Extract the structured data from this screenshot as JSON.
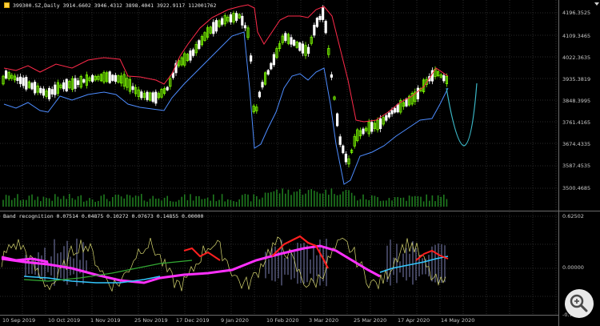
{
  "header": {
    "symbol_line": "399300.SZ,Daily  3914.6602 3946.4312 3898.4041 3922.9117  112001762"
  },
  "indicator": {
    "label_line": "Band recognition 0.07514 0.04875 0.10272 0.07673 0.14855 0.00000"
  },
  "price_scale": {
    "main": [
      "4196.3525",
      "4109.3465",
      "4022.3635",
      "3935.3819",
      "3848.3995",
      "3761.4165",
      "3674.4335",
      "3587.4535",
      "3500.4685"
    ],
    "sub": [
      "0.62502",
      "0.00000",
      "-0.74"
    ]
  },
  "time_scale": [
    "10 Sep 2019",
    "10 Oct 2019",
    "1 Nov 2019",
    "25 Nov 2019",
    "17 Dec 2019",
    "9 Jan 2020",
    "10 Feb 2020",
    "3 Mar 2020",
    "25 Mar 2020",
    "17 Apr 2020",
    "14 May 2020"
  ],
  "colors": {
    "background": "#000000",
    "grid": "#2a2a2a",
    "candle_up": "#7cfc00",
    "candle_down": "#ffffff",
    "band_upper": "#ff2a4a",
    "band_lower": "#4d8cff",
    "forecast": "#3bb8c8",
    "volume": "#1f7a1f",
    "osc_red": "#ff2020",
    "osc_magenta": "#ff30ff",
    "osc_green": "#33aa33",
    "osc_cyan": "#33c8ff",
    "osc_yellow": "#d8d870",
    "osc_hist": "#b0b8ff"
  },
  "zoom": {
    "icon": "magnifier-icon"
  }
}
